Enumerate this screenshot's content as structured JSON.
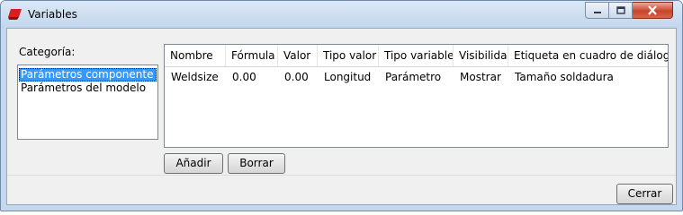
{
  "window": {
    "title": "Variables",
    "icon": "app-red-icon"
  },
  "titlebar_controls": {
    "minimize": "minimize-icon",
    "maximize": "maximize-icon",
    "close": "close-icon"
  },
  "category": {
    "label": "Categoría:",
    "items": [
      "Parámetros componente",
      "Parámetros del modelo"
    ],
    "selected_index": 0
  },
  "table": {
    "columns": [
      "Nombre",
      "Fórmula",
      "Valor",
      "Tipo valor",
      "Tipo variable",
      "Visibilidad",
      "Etiqueta en cuadro de diálogo"
    ],
    "rows": [
      [
        "Weldsize",
        "0.00",
        "0.00",
        "Longitud",
        "Parámetro",
        "Mostrar",
        "Tamaño soldadura"
      ]
    ]
  },
  "buttons": {
    "add": "Añadir",
    "delete": "Borrar",
    "close": "Cerrar"
  },
  "colors": {
    "selection": "#3399ff",
    "titlebar": "#c5d8ee",
    "close_button": "#c7442a"
  }
}
